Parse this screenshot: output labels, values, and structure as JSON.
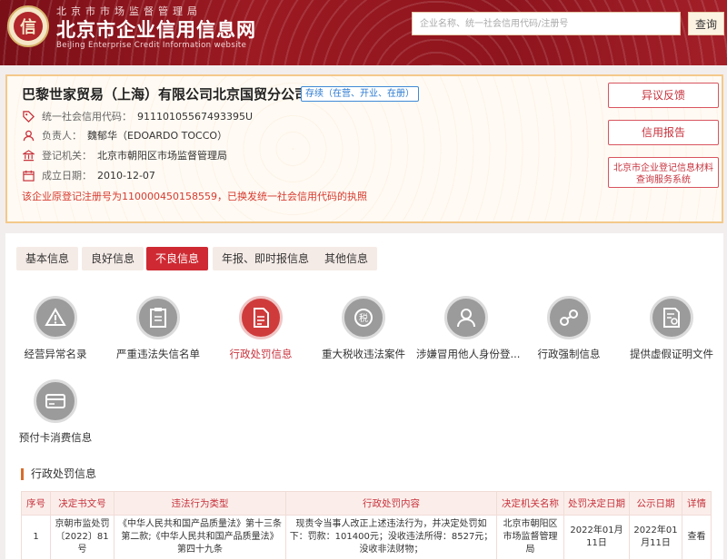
{
  "header": {
    "logo_char": "信",
    "subtitle": "北京市市场监督管理局",
    "title": "北京市企业信用信息网",
    "title_en": "BeiJing Enterprise Credit Information website",
    "search_placeholder": "企业名称、统一社会信用代码/注册号",
    "search_button": "查询"
  },
  "company": {
    "name": "巴黎世家贸易（上海）有限公司北京国贸分公司",
    "status": "存续（在营、开业、在册）",
    "credit_code_label": "统一社会信用代码：",
    "credit_code": "91110105567493395U",
    "person_label": "负责人：",
    "person": "魏郁华（EDOARDO TOCCO）",
    "authority_label": "登记机关：",
    "authority": "北京市朝阳区市场监督管理局",
    "date_label": "成立日期：",
    "date": "2010-12-07",
    "note": "该企业原登记注册号为110000450158559，已换发统一社会信用代码的执照",
    "buttons": {
      "objection": "异议反馈",
      "credit_report": "信用报告",
      "registration_line1": "北京市企业登记信息材料",
      "registration_line2": "查询服务系统"
    }
  },
  "tabs": [
    "基本信息",
    "良好信息",
    "不良信息",
    "年报、即时报信息",
    "其他信息"
  ],
  "active_tab": 2,
  "categories": [
    {
      "label": "经营异常名录",
      "icon": "warning-icon"
    },
    {
      "label": "严重违法失信名单",
      "icon": "clipboard-icon"
    },
    {
      "label": "行政处罚信息",
      "icon": "document-icon"
    },
    {
      "label": "重大税收违法案件",
      "icon": "tax-icon"
    },
    {
      "label": "涉嫌冒用他人身份登...",
      "icon": "person-icon"
    },
    {
      "label": "行政强制信息",
      "icon": "handcuffs-icon"
    },
    {
      "label": "提供虚假证明文件",
      "icon": "certificate-icon"
    },
    {
      "label": "预付卡消费信息",
      "icon": "card-icon"
    }
  ],
  "section_title": "行政处罚信息",
  "table": {
    "headers": [
      "序号",
      "决定书文号",
      "违法行为类型",
      "行政处罚内容",
      "决定机关名称",
      "处罚决定日期",
      "公示日期",
      "详情"
    ],
    "rows": [
      {
        "index": "1",
        "doc_no": "京朝市监处罚〔2022〕81号",
        "violation": "《中华人民共和国产品质量法》第十三条第二款;《中华人民共和国产品质量法》第四十九条",
        "content": "现责令当事人改正上述违法行为，并决定处罚如下：罚款：101400元；没收违法所得：8527元；没收非法财物；",
        "authority": "北京市朝阳区市场监督管理局",
        "decision_date": "2022年01月11日",
        "publish_date": "2022年01月11日",
        "detail": "查看"
      }
    ]
  }
}
